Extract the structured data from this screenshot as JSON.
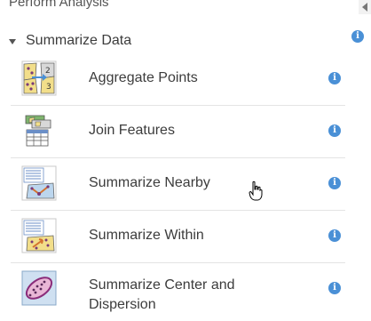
{
  "panel": {
    "title": "Perform Analysis"
  },
  "section": {
    "title": "Summarize Data",
    "info_glyph": "i"
  },
  "tools": [
    {
      "label": "Aggregate Points",
      "icon": "aggregate-points-icon",
      "info_glyph": "i"
    },
    {
      "label": "Join Features",
      "icon": "join-features-icon",
      "info_glyph": "i"
    },
    {
      "label": "Summarize Nearby",
      "icon": "summarize-nearby-icon",
      "info_glyph": "i"
    },
    {
      "label": "Summarize Within",
      "icon": "summarize-within-icon",
      "info_glyph": "i"
    },
    {
      "label": "Summarize Center and Dispersion",
      "icon": "summarize-center-dispersion-icon",
      "info_glyph": "i"
    }
  ],
  "colors": {
    "info_blue": "#4a90d6",
    "text": "#3c3c3c",
    "divider": "#e4e4e4"
  }
}
